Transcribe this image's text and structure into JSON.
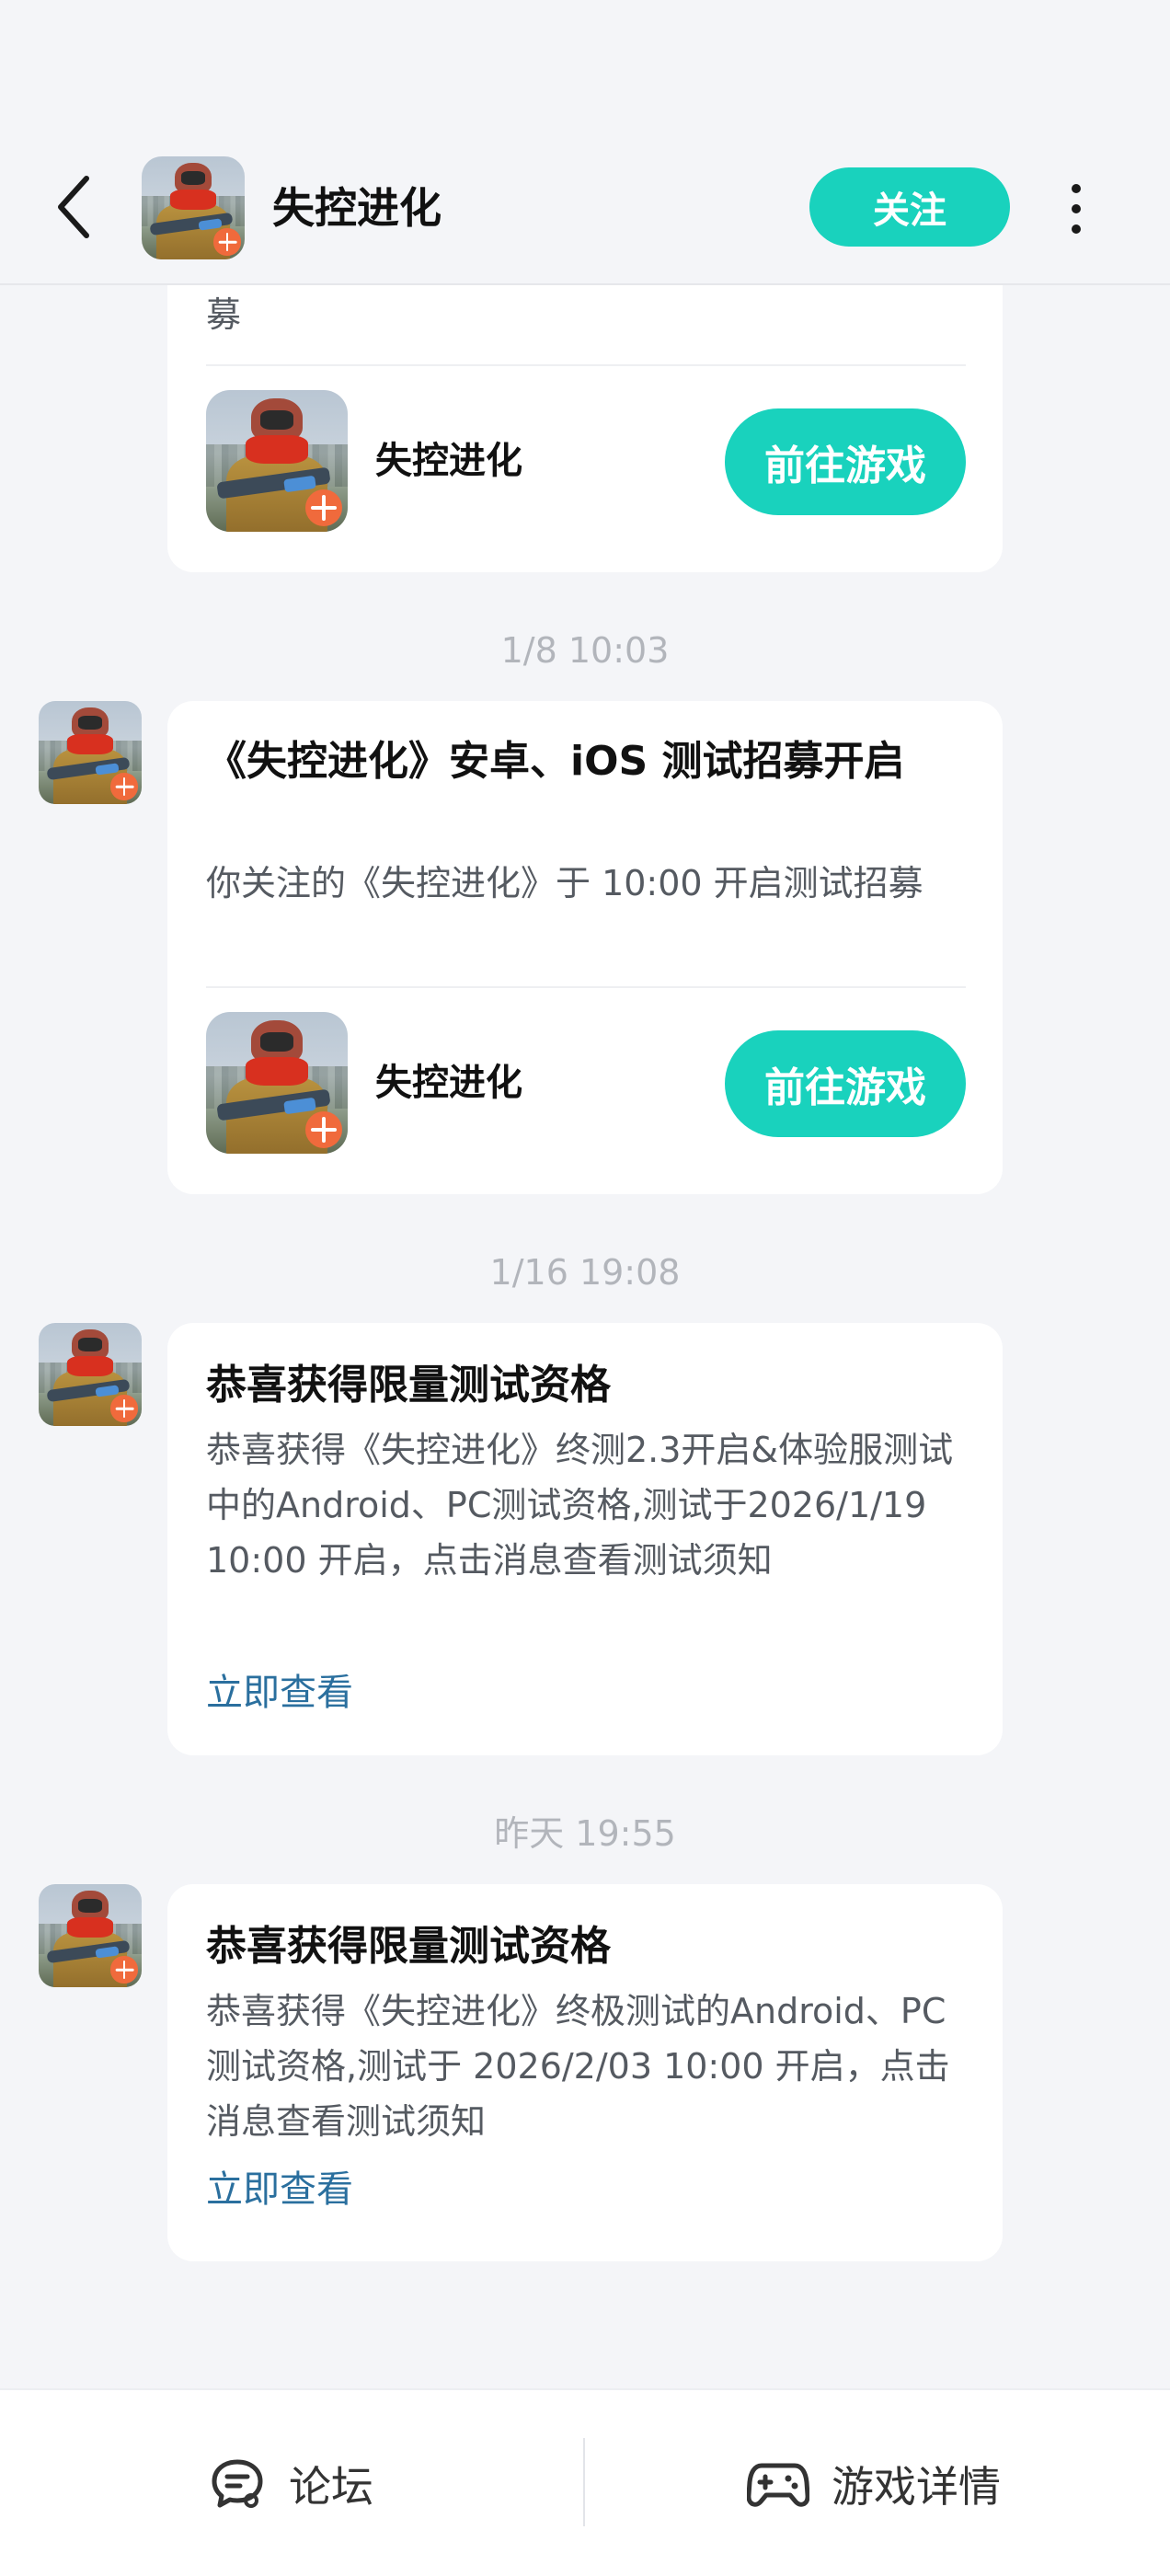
{
  "header": {
    "title": "失控进化",
    "follow_label": "关注"
  },
  "messages": [
    {
      "body": "募",
      "game_name": "失控进化",
      "button_label": "前往游戏"
    },
    {
      "timestamp": "1/8  10:03",
      "title": "《失控进化》安卓、iOS 测试招募开启",
      "body": "你关注的《失控进化》于 10:00 开启测试招募",
      "game_name": "失控进化",
      "button_label": "前往游戏"
    },
    {
      "timestamp": "1/16  19:08",
      "title": "恭喜获得限量测试资格",
      "body": "恭喜获得《失控进化》终测2.3开启&体验服测试中的Android、PC测试资格,测试于2026/1/19 10:00 开启，点击消息查看测试须知",
      "link_label": "立即查看"
    },
    {
      "timestamp": "昨天  19:55",
      "title": "恭喜获得限量测试资格",
      "body": "恭喜获得《失控进化》终极测试的Android、PC测试资格,测试于 2026/2/03 10:00 开启，点击消息查看测试须知",
      "link_label": "立即查看"
    }
  ],
  "bottom_nav": {
    "forum_label": "论坛",
    "details_label": "游戏详情"
  },
  "colors": {
    "accent": "#19d2bd",
    "link": "#2a6f9e",
    "background": "#f4f5f8"
  },
  "icons": [
    "back-arrow-icon",
    "more-vertical-icon",
    "forum-chat-icon",
    "gamepad-icon"
  ]
}
